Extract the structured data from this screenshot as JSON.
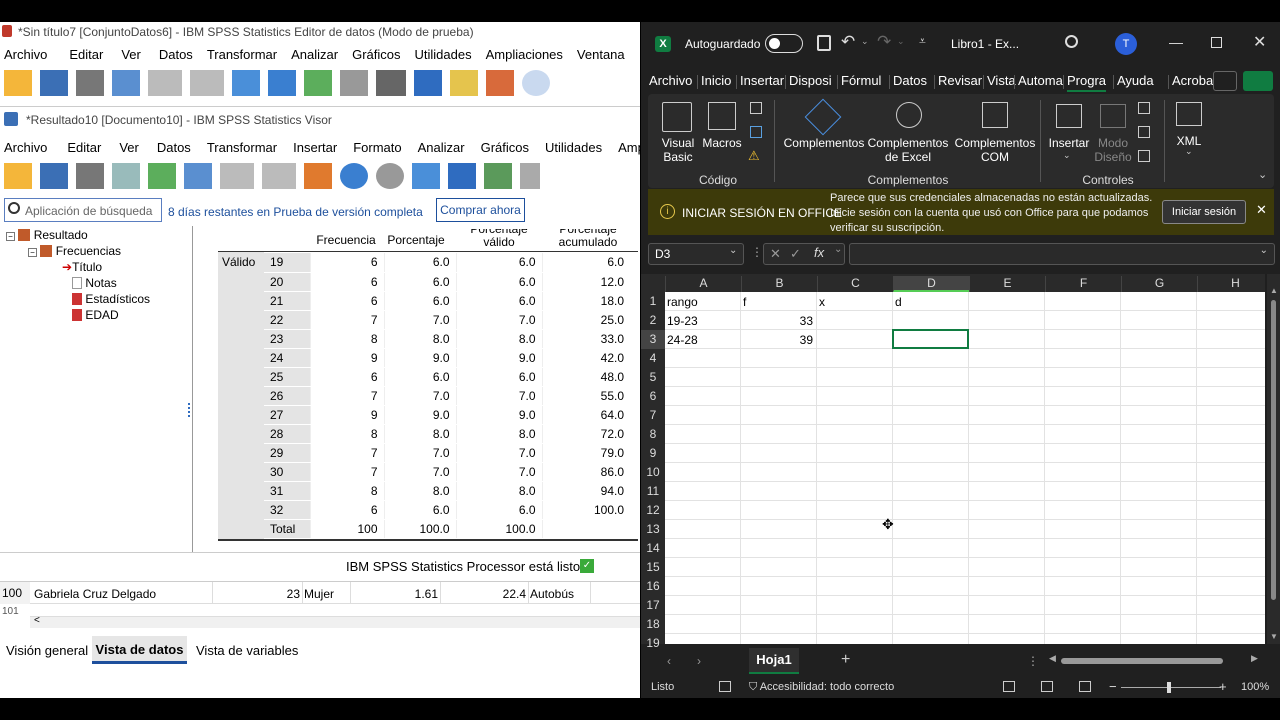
{
  "spss_editor": {
    "title": "*Sin título7 [ConjuntoDatos6] - IBM SPSS Statistics Editor de datos (Modo de prueba)",
    "menu": [
      "Archivo",
      "Editar",
      "Ver",
      "Datos",
      "Transformar",
      "Analizar",
      "Gráficos",
      "Utilidades",
      "Ampliaciones",
      "Ventana"
    ]
  },
  "spss_viewer": {
    "title": "*Resultado10 [Documento10] - IBM SPSS Statistics Visor",
    "menu": [
      "Archivo",
      "Editar",
      "Ver",
      "Datos",
      "Transformar",
      "Insertar",
      "Formato",
      "Analizar",
      "Gráficos",
      "Utilidades",
      "Amp"
    ],
    "search_placeholder": "Aplicación de búsqueda",
    "trial_text": "8 días restantes en Prueba de versión completa",
    "buy_label": "Comprar ahora",
    "tree": [
      "Resultado",
      "Frecuencias",
      "Título",
      "Notas",
      "Estadísticos",
      "EDAD"
    ],
    "table": {
      "headers": [
        "Frecuencia",
        "Porcentaje",
        "Porcentaje válido",
        "Porcentaje acumulado"
      ],
      "group_label": "Válido",
      "rows": [
        [
          "19",
          "6",
          "6.0",
          "6.0",
          "6.0"
        ],
        [
          "20",
          "6",
          "6.0",
          "6.0",
          "12.0"
        ],
        [
          "21",
          "6",
          "6.0",
          "6.0",
          "18.0"
        ],
        [
          "22",
          "7",
          "7.0",
          "7.0",
          "25.0"
        ],
        [
          "23",
          "8",
          "8.0",
          "8.0",
          "33.0"
        ],
        [
          "24",
          "9",
          "9.0",
          "9.0",
          "42.0"
        ],
        [
          "25",
          "6",
          "6.0",
          "6.0",
          "48.0"
        ],
        [
          "26",
          "7",
          "7.0",
          "7.0",
          "55.0"
        ],
        [
          "27",
          "9",
          "9.0",
          "9.0",
          "64.0"
        ],
        [
          "28",
          "8",
          "8.0",
          "8.0",
          "72.0"
        ],
        [
          "29",
          "7",
          "7.0",
          "7.0",
          "79.0"
        ],
        [
          "30",
          "7",
          "7.0",
          "7.0",
          "86.0"
        ],
        [
          "31",
          "8",
          "8.0",
          "8.0",
          "94.0"
        ],
        [
          "32",
          "6",
          "6.0",
          "6.0",
          "100.0"
        ],
        [
          "Total",
          "100",
          "100.0",
          "100.0",
          ""
        ]
      ]
    },
    "status": "IBM SPSS Statistics Processor está listo"
  },
  "data_row": {
    "num": "100",
    "name": "Gabriela Cruz Delgado",
    "age": "23",
    "sex": "Mujer",
    "height": "1.61",
    "bmi": "22.4",
    "transport": "Autobús",
    "next": "101"
  },
  "spss_tabs": [
    "Visión general",
    "Vista de datos",
    "Vista de variables"
  ],
  "excel": {
    "autosave": "Autoguardado",
    "filename": "Libro1 - Ex...",
    "avatar": "T",
    "tabs": [
      "Archivo",
      "Inicio",
      "Insertar",
      "Disposi",
      "Fórmul",
      "Datos",
      "Revisar",
      "Vista",
      "Automa",
      "Progra",
      "Ayuda",
      "Acroba"
    ],
    "ribbon": {
      "vb": "Visual Basic",
      "macros": "Macros",
      "codigo": "Código",
      "comp": "Complementos",
      "comp_excel": "Complementos de Excel",
      "comp_com": "Complementos COM",
      "comp_group": "Complementos",
      "insertar": "Insertar",
      "modo": "Modo Diseño",
      "controles": "Controles",
      "xml": "XML"
    },
    "notice": {
      "title": "INICIAR SESIÓN EN OFFICE",
      "text": "Parece que sus credenciales almacenadas no están actualizadas. Inicie sesión con la cuenta que usó con Office para que podamos verificar su suscripción.",
      "button": "Iniciar sesión"
    },
    "namebox": "D3",
    "fx": "fx",
    "columns": [
      "A",
      "B",
      "C",
      "D",
      "E",
      "F",
      "G",
      "H"
    ],
    "rows": [
      "1",
      "2",
      "3",
      "4",
      "5",
      "6",
      "7",
      "8",
      "9",
      "10",
      "11",
      "12",
      "13",
      "14",
      "15",
      "16",
      "17",
      "18",
      "19"
    ],
    "cells": {
      "A1": "rango",
      "B1": "f",
      "C1": "x",
      "D1": "d",
      "A2": "19-23",
      "B2": "33",
      "A3": "24-28",
      "B3": "39"
    },
    "sheet": "Hoja1",
    "status_left": "Listo",
    "accessibility": "Accesibilidad: todo correcto",
    "zoom": "100%"
  },
  "colors": {
    "excel_green": "#107c41",
    "notice_bg": "#3d3a0a",
    "spss_blue": "#1d4f9c"
  }
}
